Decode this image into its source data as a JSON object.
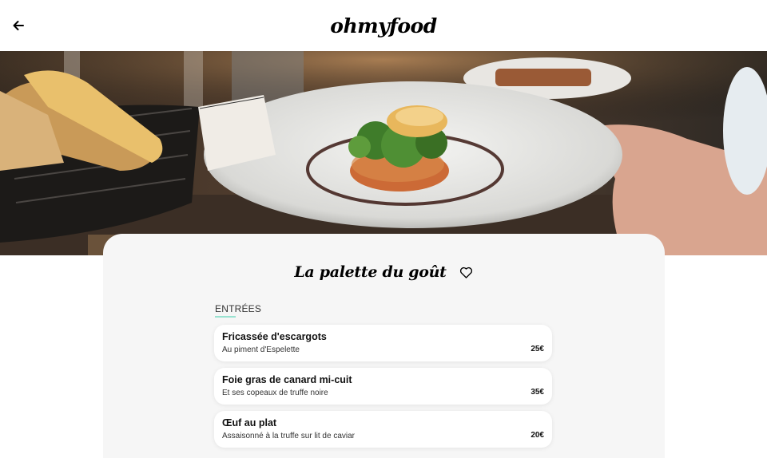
{
  "header": {
    "logo": "ohmyfood",
    "back_icon": "arrow-left-icon"
  },
  "restaurant": {
    "name": "La palette du goût",
    "favorite_icon": "heart-outline-icon"
  },
  "menu": {
    "section_title": "ENTRÉES",
    "accent_color": "#99e2d0",
    "dishes": [
      {
        "name": "Fricassée d'escargots",
        "description": "Au piment d'Espelette",
        "price": "25€"
      },
      {
        "name": "Foie gras de canard mi-cuit",
        "description": "Et ses copeaux de truffe noire",
        "price": "35€"
      },
      {
        "name": "Œuf au plat",
        "description": "Assaisonné à la truffe sur lit de caviar",
        "price": "20€"
      }
    ]
  }
}
